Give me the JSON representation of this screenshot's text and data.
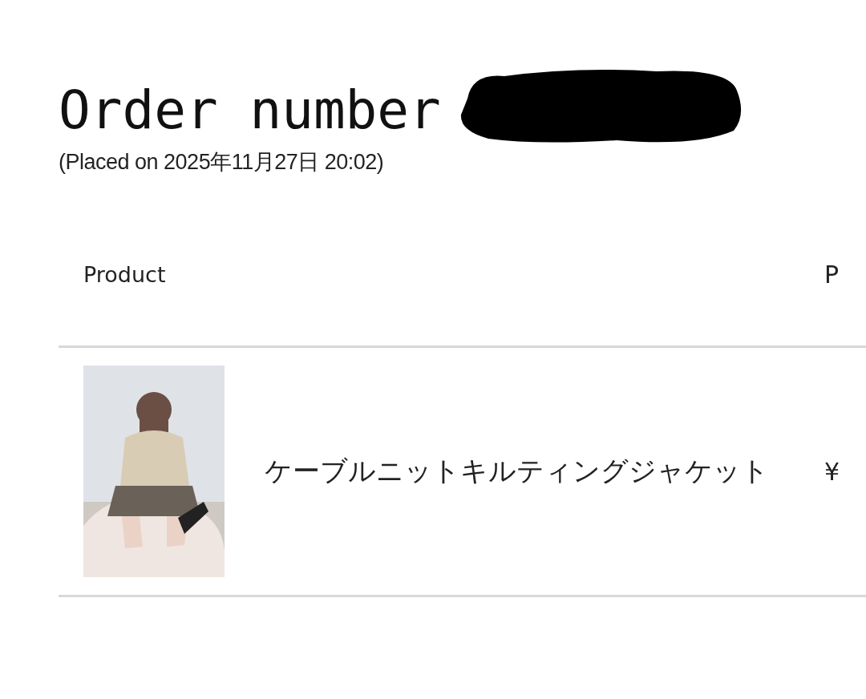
{
  "order": {
    "heading": "Order number",
    "placed": "(Placed on 2025年11月27日 20:02)"
  },
  "table": {
    "columns": [
      "Product",
      "P"
    ],
    "rows": [
      {
        "product": {
          "kind": "picture",
          "name": "ケーブルニットキルティングジャケット"
        },
        "column_2": "¥"
      }
    ]
  }
}
